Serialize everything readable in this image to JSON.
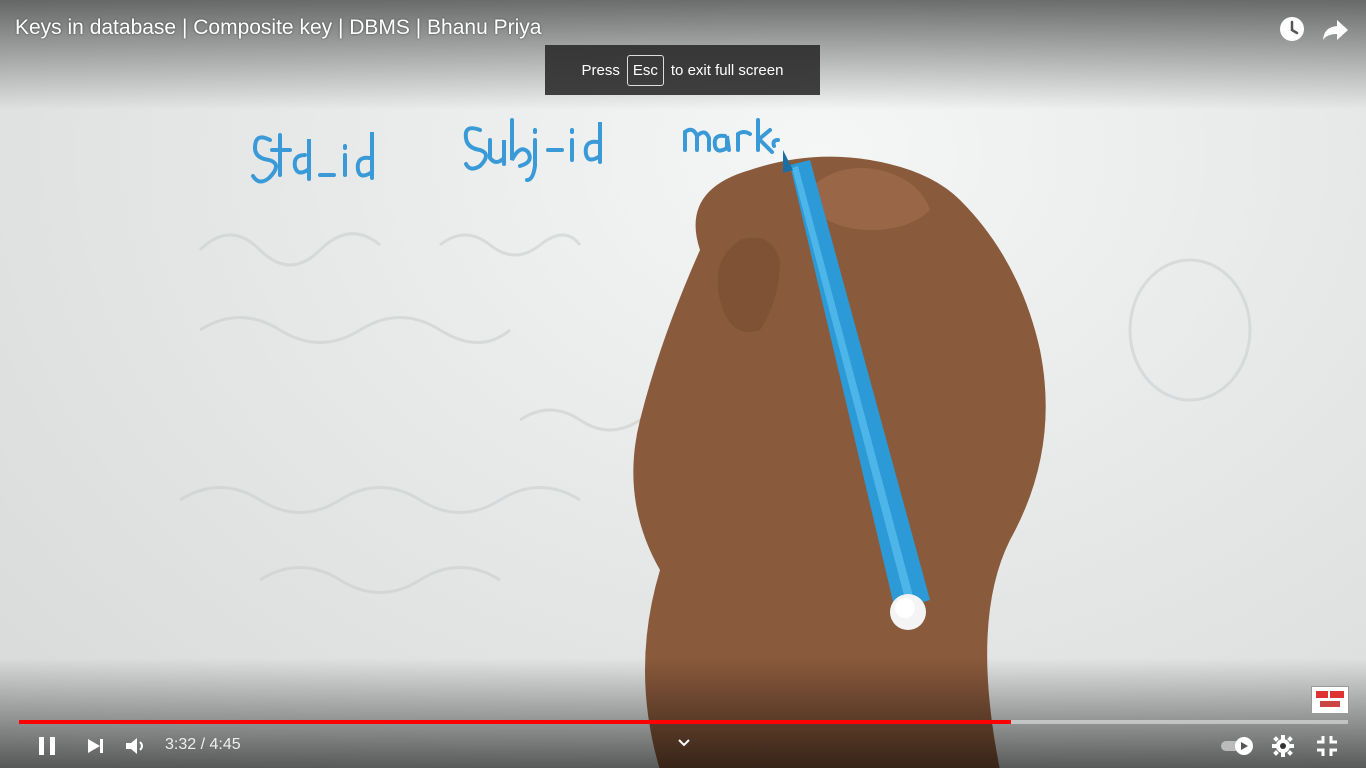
{
  "video": {
    "title": "Keys in database | Composite key | DBMS | Bhanu Priya",
    "handwriting": [
      "Std_id",
      "Subj-id",
      "marks"
    ]
  },
  "fullscreen_notice": {
    "prefix": "Press",
    "key": "Esc",
    "suffix": "to exit full screen"
  },
  "top_actions": [
    {
      "name": "watch-later-icon"
    },
    {
      "name": "share-icon"
    }
  ],
  "controls": {
    "time_display": "3:32 / 4:45",
    "progress_fraction": 0.7466,
    "progress_color": "#ff0000",
    "icons": [
      "pause-icon",
      "next-icon",
      "volume-icon",
      "chevron-up-icon",
      "autoplay-toggle",
      "settings-gear-icon",
      "exit-fullscreen-icon"
    ]
  }
}
